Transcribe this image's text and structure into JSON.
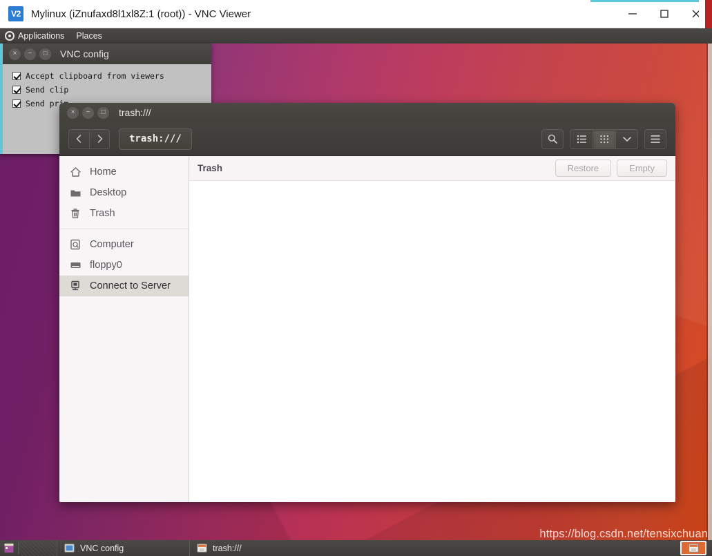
{
  "vnc_window": {
    "logo_text": "V2",
    "title": "Mylinux (iZnufaxd8l1xl8Z:1 (root)) - VNC Viewer",
    "minimize_label": "Minimize",
    "maximize_label": "Maximize",
    "close_label": "Close"
  },
  "top_panel": {
    "applications": "Applications",
    "places": "Places"
  },
  "vnc_config": {
    "title": "VNC config",
    "close_glyph": "×",
    "minimize_glyph": "−",
    "maximize_glyph": "□",
    "options": [
      "Accept clipboard from viewers",
      "Send clip",
      "Send prim"
    ]
  },
  "file_manager": {
    "title": "trash:///",
    "close_glyph": "×",
    "minimize_glyph": "−",
    "maximize_glyph": "□",
    "toolbar": {
      "back_glyph": "‹",
      "forward_glyph": "›",
      "path": "trash:///",
      "search_label": "Search",
      "list_view_label": "List view",
      "grid_view_label": "Grid view",
      "view_options_label": "View options",
      "menu_label": "Menu"
    },
    "sidebar": {
      "places": [
        {
          "label": "Home",
          "icon": "home-icon"
        },
        {
          "label": "Desktop",
          "icon": "folder-icon"
        },
        {
          "label": "Trash",
          "icon": "trash-icon"
        }
      ],
      "devices": [
        {
          "label": "Computer",
          "icon": "computer-icon"
        },
        {
          "label": "floppy0",
          "icon": "floppy-icon"
        },
        {
          "label": "Connect to Server",
          "icon": "server-icon"
        }
      ]
    },
    "content": {
      "header_title": "Trash",
      "restore_label": "Restore",
      "empty_label": "Empty",
      "file_list": []
    }
  },
  "taskbar": {
    "tasks": [
      {
        "label": "VNC config",
        "icon": "window-icon"
      },
      {
        "label": "trash:///",
        "icon": "file-manager-icon"
      }
    ],
    "show_desktop_label": "Show Desktop"
  },
  "watermark": "https://blog.csdn.net/tensixchuan",
  "colors": {
    "ubuntu_purple": "#77216f",
    "ubuntu_orange": "#dd4814",
    "panel_dark": "#3f3d39",
    "accent_teal": "#5fc7d6",
    "selected_row": "#dedad5"
  }
}
